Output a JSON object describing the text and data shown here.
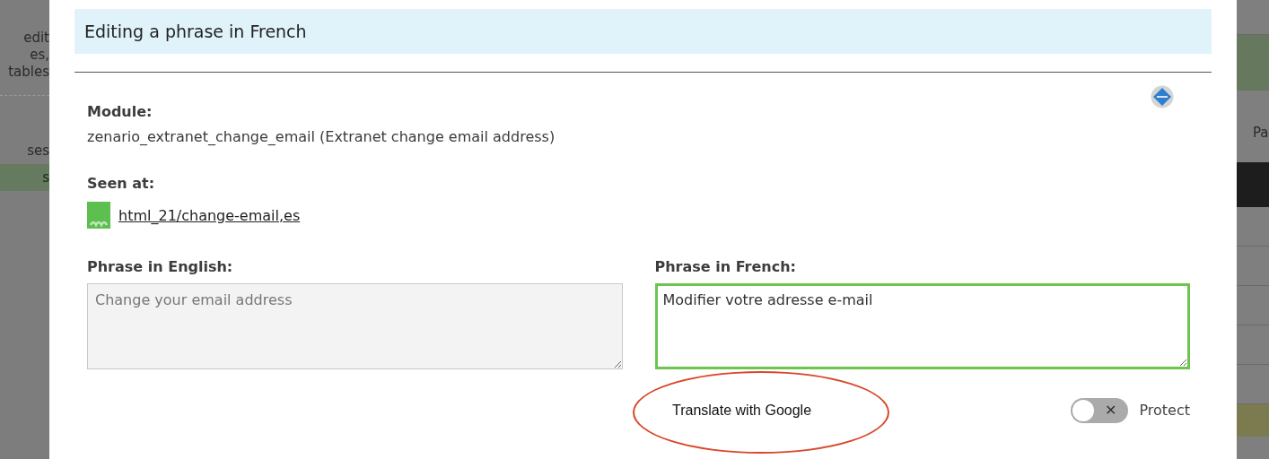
{
  "background_left": {
    "text_lines": [
      "edit",
      "es,",
      "tables"
    ],
    "items": [
      {
        "label": "ses",
        "selected": false
      },
      {
        "label": "s",
        "selected": true
      }
    ]
  },
  "background_right": {
    "items": [
      {
        "label": "Pa"
      }
    ]
  },
  "dialog": {
    "title": "Editing a phrase in French",
    "module": {
      "label": "Module:",
      "value": "zenario_extranet_change_email (Extranet change email address)"
    },
    "seen_at": {
      "label": "Seen at:",
      "link": "html_21/change-email,es"
    },
    "english": {
      "label": "Phrase in English:",
      "value": "Change your email address",
      "disabled": true
    },
    "french": {
      "label": "Phrase in French:",
      "value": "Modifier votre adresse e-mail"
    },
    "translate": {
      "label": "Translate with Google",
      "highlighted": true
    },
    "protect": {
      "label": "Protect",
      "on": false,
      "symbol": "✕"
    }
  }
}
